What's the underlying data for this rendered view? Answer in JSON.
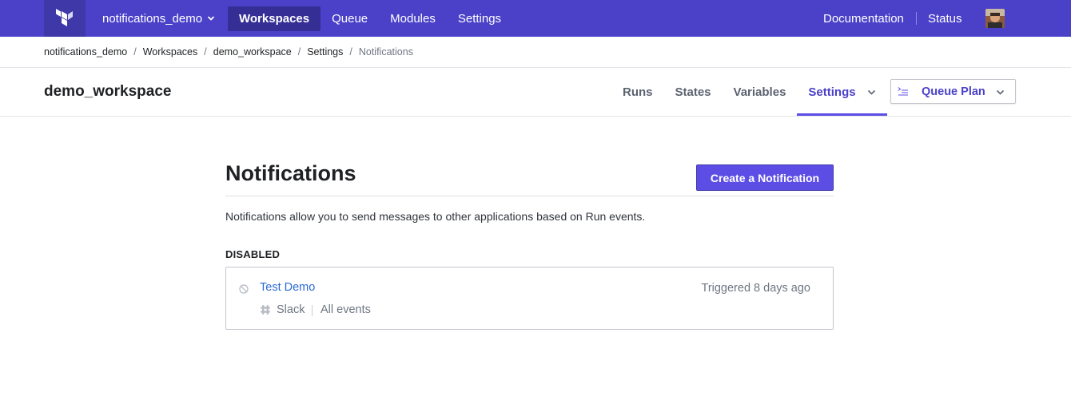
{
  "topnav": {
    "org": "notifications_demo",
    "links": [
      "Workspaces",
      "Queue",
      "Modules",
      "Settings"
    ],
    "documentation": "Documentation",
    "status": "Status",
    "brand_color": "#4b41c9"
  },
  "breadcrumb": {
    "items": [
      "notifications_demo",
      "Workspaces",
      "demo_workspace",
      "Settings"
    ],
    "current": "Notifications",
    "separator": "/"
  },
  "workspace": {
    "title": "demo_workspace",
    "tabs": [
      "Runs",
      "States",
      "Variables",
      "Settings"
    ],
    "active_tab": "Settings",
    "queue_button": "Queue Plan"
  },
  "main": {
    "title": "Notifications",
    "create_button": "Create a Notification",
    "description": "Notifications allow you to send messages to other applications based on Run events.",
    "section_label": "DISABLED",
    "notifications": [
      {
        "name": "Test Demo",
        "triggered": "Triggered 8 days ago",
        "destination": "Slack",
        "events": "All events",
        "status_icon": "disabled-icon",
        "destination_icon": "slack-icon"
      }
    ]
  }
}
